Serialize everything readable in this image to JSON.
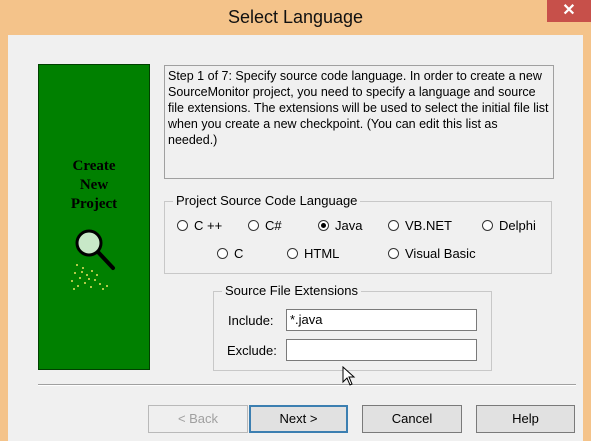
{
  "window": {
    "title": "Select Language",
    "close_glyph": "✕"
  },
  "banner": {
    "lines": [
      "Create",
      "New",
      "Project"
    ],
    "icon": "magnifier-icon",
    "bg_color": "#008000"
  },
  "description": "Step 1 of 7: Specify source code language. In order to create a new SourceMonitor project, you need to specify a language and source file extensions. The extensions will be used to select the initial file list when you create a new checkpoint. (You can edit this list as needed.)",
  "language_group": {
    "label": "Project Source Code Language",
    "options": [
      {
        "label": "C ++",
        "checked": false
      },
      {
        "label": "C#",
        "checked": false
      },
      {
        "label": "Java",
        "checked": true
      },
      {
        "label": "VB.NET",
        "checked": false
      },
      {
        "label": "Delphi",
        "checked": false
      },
      {
        "label": "C",
        "checked": false
      },
      {
        "label": "HTML",
        "checked": false
      },
      {
        "label": "Visual Basic",
        "checked": false
      }
    ]
  },
  "extensions_group": {
    "label": "Source File Extensions",
    "include_label": "Include:",
    "include_value": "*.java",
    "exclude_label": "Exclude:",
    "exclude_value": ""
  },
  "buttons": {
    "back": "< Back",
    "next": "Next >",
    "cancel": "Cancel",
    "help": "Help"
  }
}
